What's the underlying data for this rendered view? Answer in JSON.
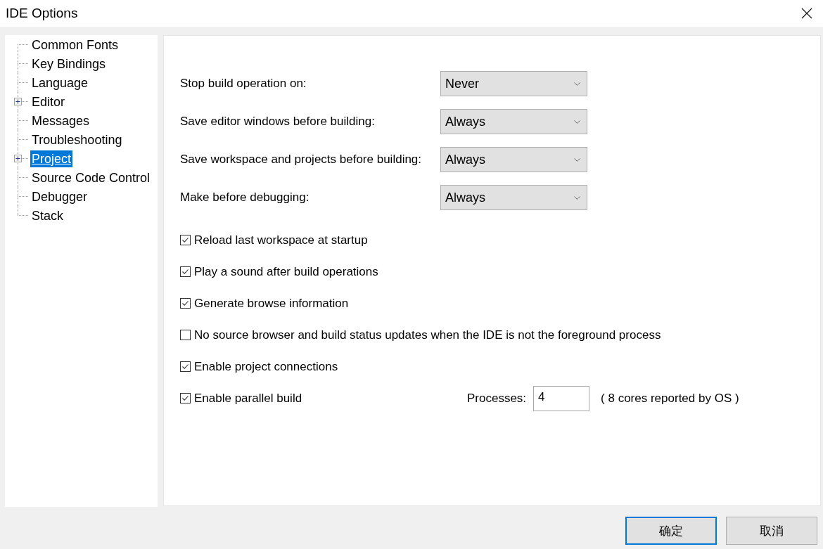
{
  "window": {
    "title": "IDE Options"
  },
  "tree": [
    {
      "label": "Common Fonts",
      "kind": "leaf",
      "selected": false
    },
    {
      "label": "Key Bindings",
      "kind": "leaf",
      "selected": false
    },
    {
      "label": "Language",
      "kind": "leaf",
      "selected": false
    },
    {
      "label": "Editor",
      "kind": "collapsed",
      "selected": false
    },
    {
      "label": "Messages",
      "kind": "leaf",
      "selected": false
    },
    {
      "label": "Troubleshooting",
      "kind": "leaf",
      "selected": false
    },
    {
      "label": "Project",
      "kind": "collapsed",
      "selected": true
    },
    {
      "label": "Source Code Control",
      "kind": "leaf",
      "selected": false
    },
    {
      "label": "Debugger",
      "kind": "leaf",
      "selected": false
    },
    {
      "label": "Stack",
      "kind": "leaf",
      "selected": false
    }
  ],
  "settings": {
    "dropdowns": [
      {
        "label": "Stop build operation on:",
        "value": "Never"
      },
      {
        "label": "Save editor windows before building:",
        "value": "Always"
      },
      {
        "label": "Save workspace and projects before building:",
        "value": "Always"
      },
      {
        "label": "Make before debugging:",
        "value": "Always"
      }
    ],
    "checkboxes": [
      {
        "label": "Reload last workspace at startup",
        "checked": true
      },
      {
        "label": "Play a sound after build operations",
        "checked": true
      },
      {
        "label": "Generate browse information",
        "checked": true
      },
      {
        "label": "No source browser and build status updates when the IDE is not the foreground process",
        "checked": false
      },
      {
        "label": "Enable project connections",
        "checked": true
      },
      {
        "label": "Enable parallel build",
        "checked": true,
        "processes": {
          "label": "Processes:",
          "value": "4",
          "note": "( 8 cores reported by OS )"
        }
      }
    ]
  },
  "buttons": [
    {
      "label": "确定",
      "default": true
    },
    {
      "label": "取消",
      "default": false
    }
  ]
}
